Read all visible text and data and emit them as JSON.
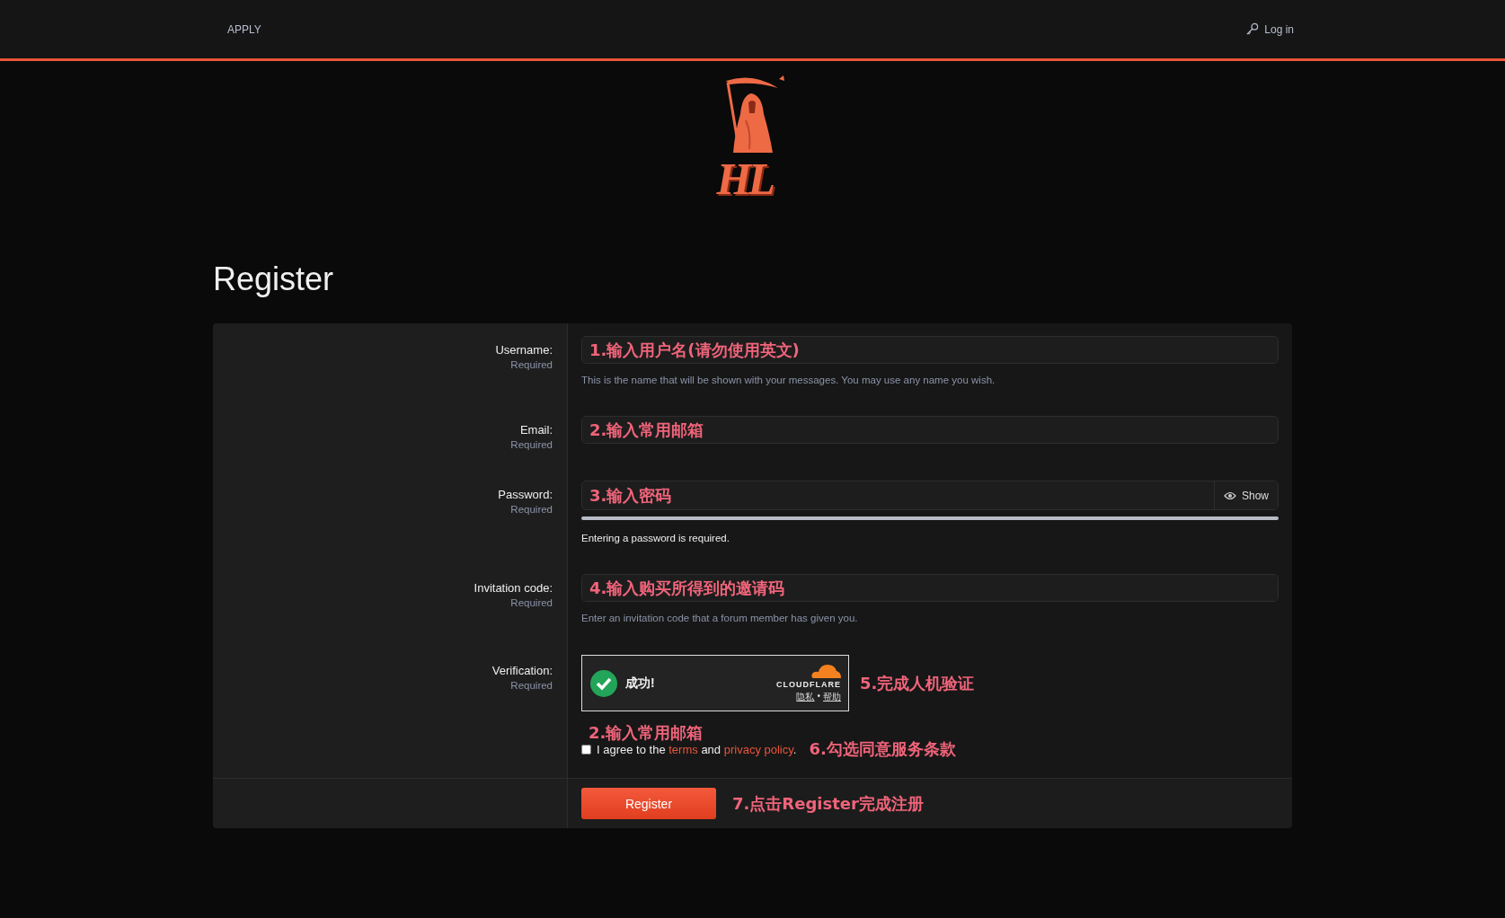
{
  "nav": {
    "apply": "APPLY",
    "login": "Log in"
  },
  "logo": {
    "text": "HL"
  },
  "title": "Register",
  "fields": [
    {
      "kind": "text",
      "label": "Username:",
      "required": "Required",
      "annotation": "1.输入用户名(请勿使用英文)",
      "explain": "This is the name that will be shown with your messages. You may use any name you wish."
    },
    {
      "kind": "text",
      "label": "Email:",
      "required": "Required",
      "annotation": "2.输入常用邮箱"
    },
    {
      "kind": "password",
      "label": "Password:",
      "required": "Required",
      "annotation": "3.输入密码",
      "show": "Show",
      "explain": "Entering a password is required."
    },
    {
      "kind": "text",
      "label": "Invitation code:",
      "required": "Required",
      "annotation": "4.输入购买所得到的邀请码",
      "explain": "Enter an invitation code that a forum member has given you."
    }
  ],
  "verification": {
    "label": "Verification:",
    "required": "Required",
    "status": "成功!",
    "brand": "CLOUDFLARE",
    "privacy": "隐私",
    "sep": "•",
    "help": "帮助",
    "annotation": "5.完成人机验证"
  },
  "agree": {
    "overlay_annotation": "2.输入常用邮箱",
    "checked": false,
    "prefix": "I agree to the",
    "terms": "terms",
    "and": "and",
    "privacy": "privacy policy",
    "end": ".",
    "annotation": "6.勾选同意服务条款"
  },
  "submit": {
    "label": "Register",
    "annotation": "7.点击Register完成注册"
  }
}
